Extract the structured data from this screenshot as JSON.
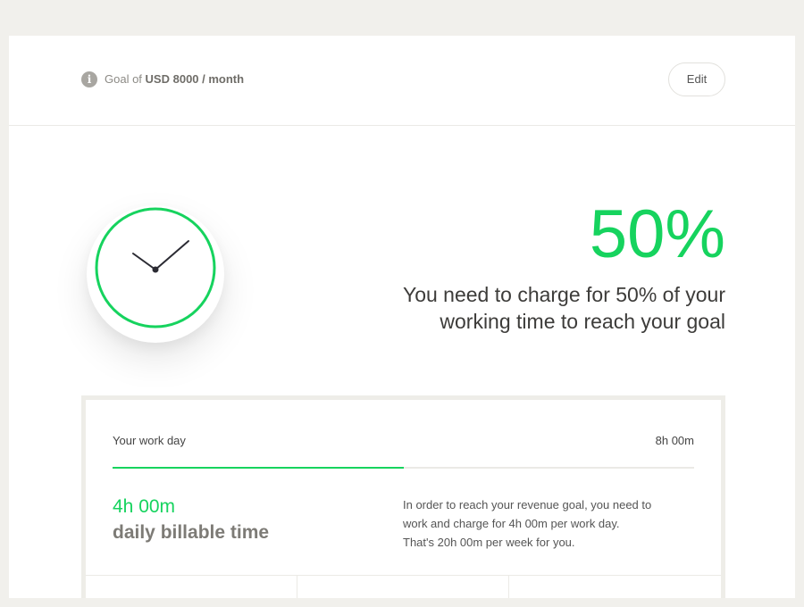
{
  "header": {
    "goal_prefix": "Goal of",
    "goal_amount": "USD 8000 / month",
    "edit_label": "Edit"
  },
  "hero": {
    "percent": "50%",
    "subtitle_line1": "You need to charge for 50% of your",
    "subtitle_line2": "working time to reach your goal"
  },
  "workday": {
    "label": "Your work day",
    "value": "8h 00m",
    "billable_fraction": 0.5,
    "billable_time": "4h 00m",
    "billable_label": "daily billable time",
    "explanation_line1": "In order to reach your revenue goal, you need to",
    "explanation_line2": "work and charge for 4h 00m per work day.",
    "explanation_line3": "That's 20h 00m per week for you."
  },
  "icons": {
    "info": "info-icon",
    "clock": "clock-icon"
  },
  "colors": {
    "accent": "#16d35e",
    "background": "#f1f0ec",
    "clock_hands": "#2b2b33"
  }
}
